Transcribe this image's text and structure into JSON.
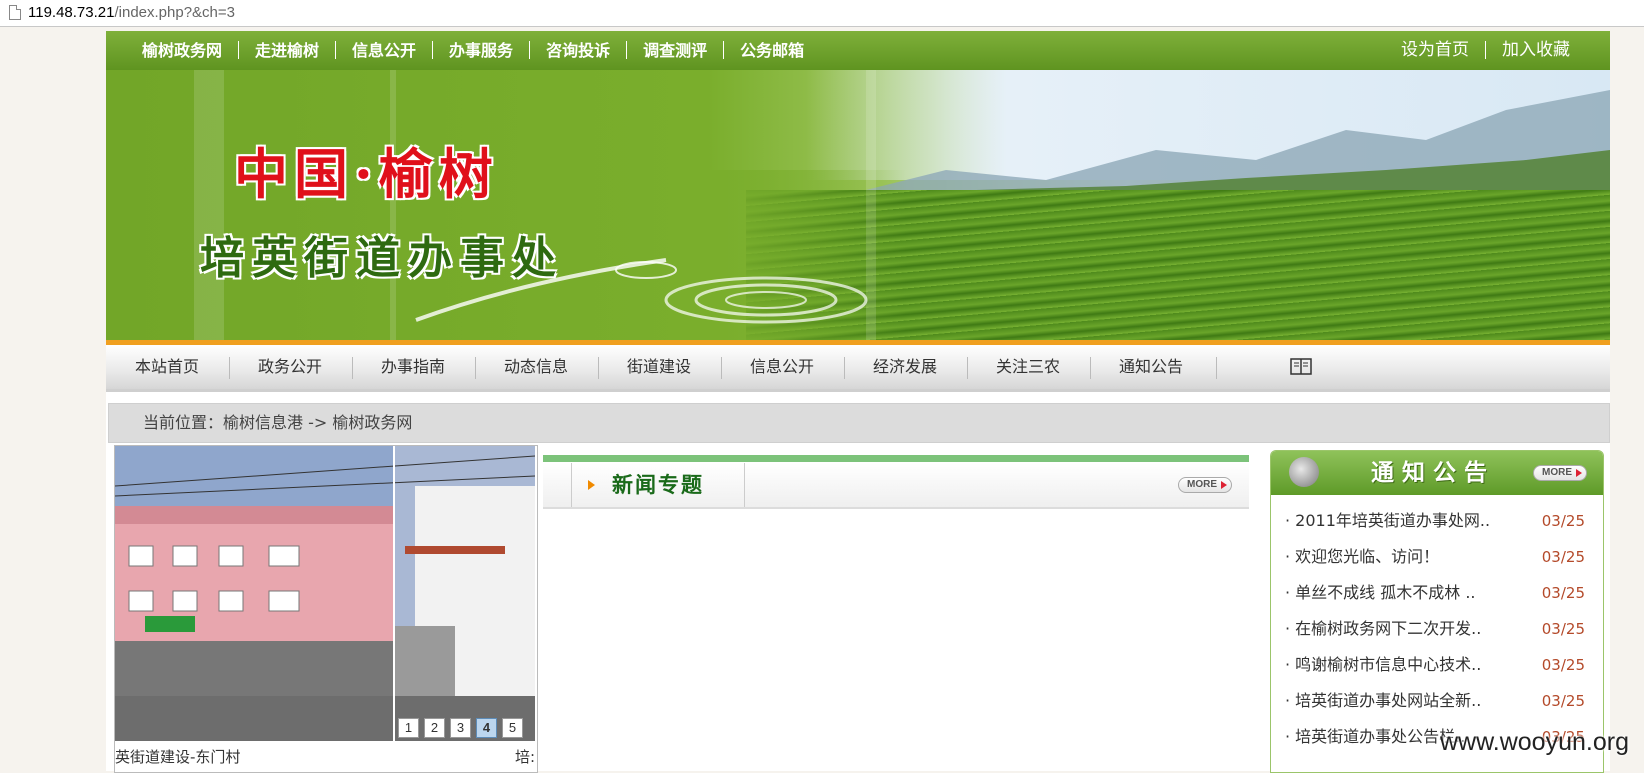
{
  "browser": {
    "url_host": "119.48.73.21",
    "url_path": "/index.php?&ch=3"
  },
  "topbar": {
    "links": [
      "榆树政务网",
      "走进榆树",
      "信息公开",
      "办事服务",
      "咨询投诉",
      "调查测评",
      "公务邮箱"
    ],
    "set_home": "设为首页",
    "add_fav": "加入收藏"
  },
  "banner": {
    "title_line1": "中国·榆树",
    "title_line2": "培英街道办事处"
  },
  "main_nav": {
    "items": [
      "本站首页",
      "政务公开",
      "办事指南",
      "动态信息",
      "街道建设",
      "信息公开",
      "经济发展",
      "关注三农",
      "通知公告"
    ],
    "book_icon": "book-icon"
  },
  "breadcrumb": {
    "text": "当前位置：榆树信息港 -> 榆树政务网"
  },
  "photo_slider": {
    "caption": "英街道建设-东门村",
    "caption_next": "培:",
    "pages": [
      "1",
      "2",
      "3",
      "4",
      "5"
    ],
    "active_page": "4"
  },
  "news": {
    "title": "新闻专题",
    "more_label": "MORE"
  },
  "notice": {
    "title": "通知公告",
    "more_label": "MORE",
    "items": [
      {
        "title": "2011年培英街道办事处网..",
        "date": "03/25"
      },
      {
        "title": "欢迎您光临、访问！",
        "date": "03/25"
      },
      {
        "title": "单丝不成线 孤木不成林 ..",
        "date": "03/25"
      },
      {
        "title": "在榆树政务网下二次开发..",
        "date": "03/25"
      },
      {
        "title": "鸣谢榆树市信息中心技术..",
        "date": "03/25"
      },
      {
        "title": "培英街道办事处网站全新..",
        "date": "03/25"
      },
      {
        "title": "培英街道办事处公告栏..",
        "date": "03/25"
      }
    ]
  },
  "watermark": "www.wooyun.org"
}
